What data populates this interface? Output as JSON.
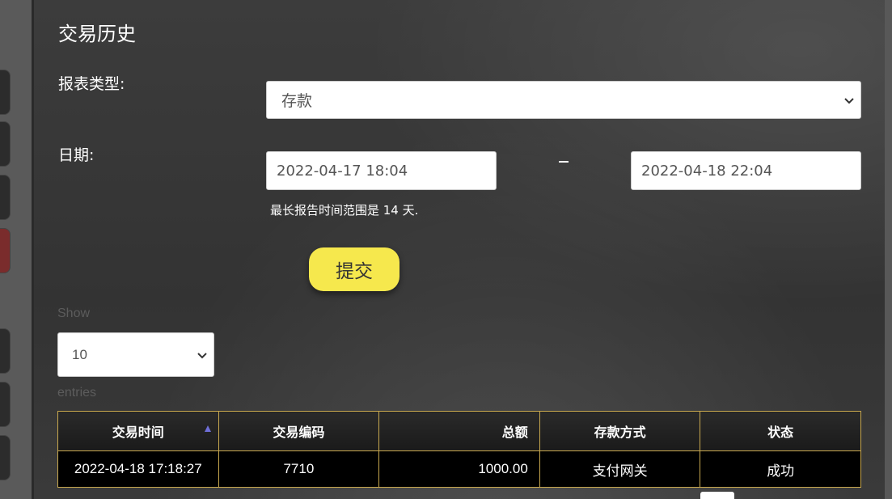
{
  "page_title": "交易历史",
  "form": {
    "report_type_label": "报表类型:",
    "report_type_value": "存款",
    "date_label": "日期:",
    "date_from": "2022-04-17 18:04",
    "date_to": "2022-04-18 22:04",
    "date_separator": "–",
    "range_hint": "最长报告时间范围是 14 天.",
    "submit_label": "提交"
  },
  "table_controls": {
    "show_label": "Show",
    "page_size": "10",
    "entries_label": "entries"
  },
  "table": {
    "columns": [
      "交易时间",
      "交易编码",
      "总额",
      "存款方式",
      "状态"
    ],
    "rows": [
      {
        "time": "2022-04-18 17:18:27",
        "code": "7710",
        "amount": "1000.00",
        "method": "支付网关",
        "status": "成功"
      }
    ]
  },
  "colors": {
    "accent_button": "#f6e84d",
    "table_border": "#c9a94f",
    "sort_arrow": "#6f6fd8"
  }
}
